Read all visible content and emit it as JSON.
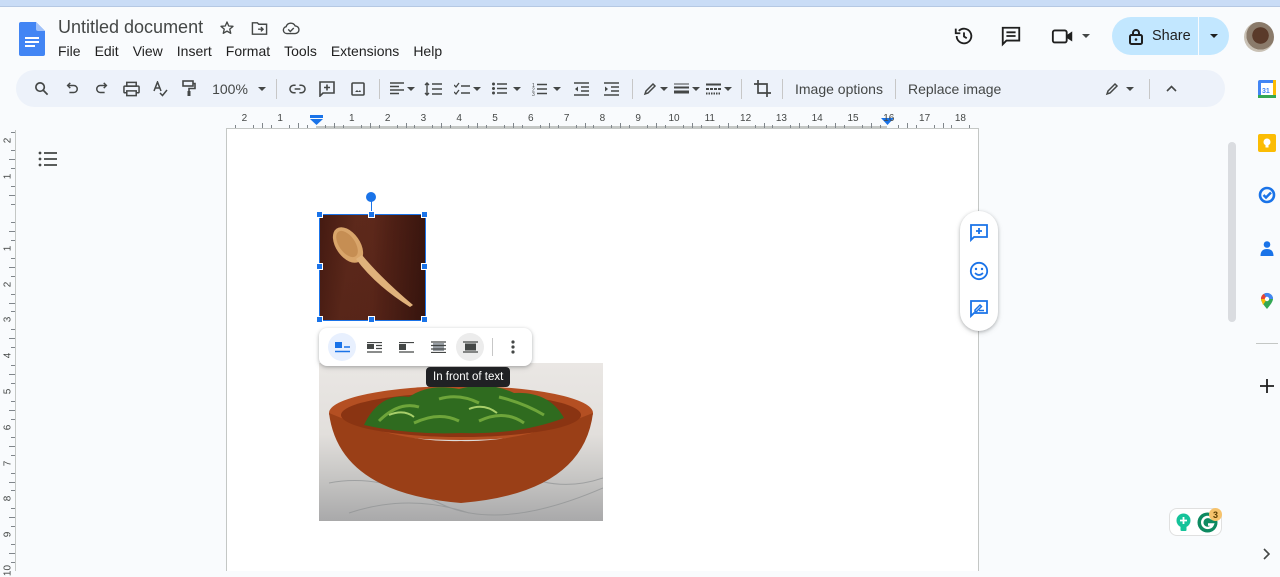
{
  "app": {
    "title": "Untitled document",
    "menu": [
      "File",
      "Edit",
      "View",
      "Insert",
      "Format",
      "Tools",
      "Extensions",
      "Help"
    ]
  },
  "header": {
    "share_label": "Share",
    "title_icons": [
      "star-icon",
      "move-to-folder-icon",
      "cloud-saved-icon"
    ],
    "right_icons": [
      "version-history-icon",
      "comments-icon",
      "meet-icon"
    ]
  },
  "toolbar": {
    "zoom": "100%",
    "image_options_label": "Image options",
    "replace_image_label": "Replace image"
  },
  "ruler": {
    "horizontal_labels": [
      "2",
      "1",
      "1",
      "2",
      "3",
      "4",
      "5",
      "6",
      "7",
      "8",
      "9",
      "10",
      "11",
      "12",
      "13",
      "14",
      "15",
      "16",
      "17",
      "18"
    ],
    "vertical_labels": [
      "2",
      "1",
      "1",
      "2",
      "3",
      "4",
      "5",
      "6",
      "7",
      "8",
      "9",
      "10"
    ]
  },
  "image_toolbar": {
    "buttons": [
      "In line",
      "Wrap text",
      "Break text",
      "Behind text",
      "In front of text"
    ],
    "active": "In line",
    "hovered": "In front of text",
    "tooltip": "In front of text"
  },
  "images": [
    {
      "description": "wooden spoon on dark wood",
      "selected": true
    },
    {
      "description": "wooden bowl with salad greens on marble",
      "selected": false
    }
  ],
  "side_actions": [
    "add-comment-icon",
    "add-emoji-reaction-icon",
    "suggest-edits-icon"
  ],
  "right_panel": [
    "calendar-icon",
    "keep-icon",
    "tasks-icon",
    "contacts-icon",
    "maps-icon",
    "add-addon-icon"
  ],
  "grammarly": {
    "badge_count": "3"
  },
  "colors": {
    "accent": "#1a73e8",
    "share_bg": "#c2e7ff",
    "toolbar_bg": "#edf2fa",
    "page_bg": "#f9fbfd"
  }
}
